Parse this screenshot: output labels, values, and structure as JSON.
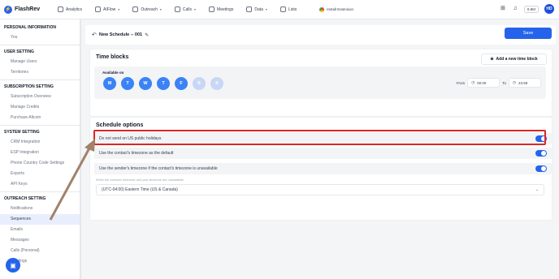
{
  "app": {
    "name": "FlashRev"
  },
  "nav": [
    {
      "label": "Analytics",
      "dropdown": false
    },
    {
      "label": "AIFlow",
      "dropdown": true
    },
    {
      "label": "Outreach",
      "dropdown": true
    },
    {
      "label": "Calls",
      "dropdown": true
    },
    {
      "label": "Meetings",
      "dropdown": false
    },
    {
      "label": "Data",
      "dropdown": true
    },
    {
      "label": "Lists",
      "dropdown": false
    }
  ],
  "extension": {
    "label": "Install Extension"
  },
  "topright": {
    "credits": "8.9M",
    "avatar": "HD"
  },
  "sidebar": {
    "sections": [
      {
        "title": "PERSONAL INFORMATION",
        "items": [
          "You"
        ]
      },
      {
        "title": "USER SETTING",
        "items": [
          "Manage Users",
          "Territories"
        ]
      },
      {
        "title": "SUBSCRIPTION SETTING",
        "items": [
          "Subscription Overview",
          "Manage Credits",
          "Purchase Altcoin"
        ]
      },
      {
        "title": "SYSTEM SETTING",
        "items": [
          "CRM Integration",
          "ESP Integration",
          "Phone Country Code Settings",
          "Exports",
          "API Keys"
        ]
      },
      {
        "title": "OUTREACH SETTING",
        "items": [
          "Notifications",
          "Sequences",
          "Emails",
          "Messages",
          "Calls (Personal)",
          "Meetings"
        ]
      }
    ],
    "active": "Sequences"
  },
  "header": {
    "schedule_name": "New Schedule -- 001",
    "save_label": "Save"
  },
  "time_blocks": {
    "title": "Time blocks",
    "add_label": "Add a new time block",
    "available_label": "Available on",
    "days": [
      {
        "label": "M",
        "on": true
      },
      {
        "label": "T",
        "on": true
      },
      {
        "label": "W",
        "on": true
      },
      {
        "label": "T",
        "on": true
      },
      {
        "label": "F",
        "on": true
      },
      {
        "label": "S",
        "on": false
      },
      {
        "label": "S",
        "on": false
      }
    ],
    "from_label": "From",
    "from_value": "00:00",
    "to_label": "To",
    "to_value": "23:59"
  },
  "schedule_options": {
    "title": "Schedule options",
    "options": [
      {
        "label": "Do not send on US public holidays",
        "enabled": true
      },
      {
        "label": "Use the contact's timezone as the default",
        "enabled": true
      },
      {
        "label": "Use the sender's timezone if the contact's timezone is unavailable",
        "enabled": true
      }
    ],
    "tz_note": "When the contact's timezone and your timezone are unavailable",
    "tz_value": "(UTC-04:00) Eastern Time (US & Canada)"
  },
  "colors": {
    "accent": "#2563eb",
    "highlight": "#dc2626",
    "arrow": "#a1826a"
  }
}
